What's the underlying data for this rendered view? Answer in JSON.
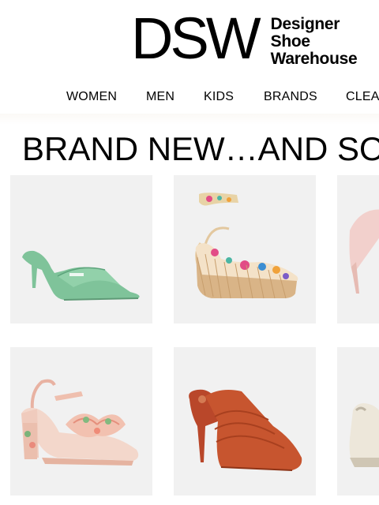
{
  "brand": {
    "mark": "DSW",
    "tagline": [
      "Designer",
      "Shoe",
      "Warehouse"
    ]
  },
  "nav": {
    "items": [
      "WOMEN",
      "MEN",
      "KIDS",
      "BRANDS",
      "CLEA"
    ]
  },
  "headline": "BRAND NEW…AND SO",
  "colors": {
    "card_bg": "#f1f1f1",
    "mint": "#7fc39a",
    "tan": "#d9b487",
    "blush": "#f2d0cc",
    "rust": "#c7552f",
    "cream": "#ede7da"
  },
  "products": [
    {
      "icon": "mint-heeled-mule-image"
    },
    {
      "icon": "floral-wedge-sandal-image"
    },
    {
      "icon": "blush-pump-image"
    },
    {
      "icon": "floral-block-heel-sandal-image"
    },
    {
      "icon": "rust-heeled-mule-image"
    },
    {
      "icon": "cream-sneaker-image"
    }
  ]
}
